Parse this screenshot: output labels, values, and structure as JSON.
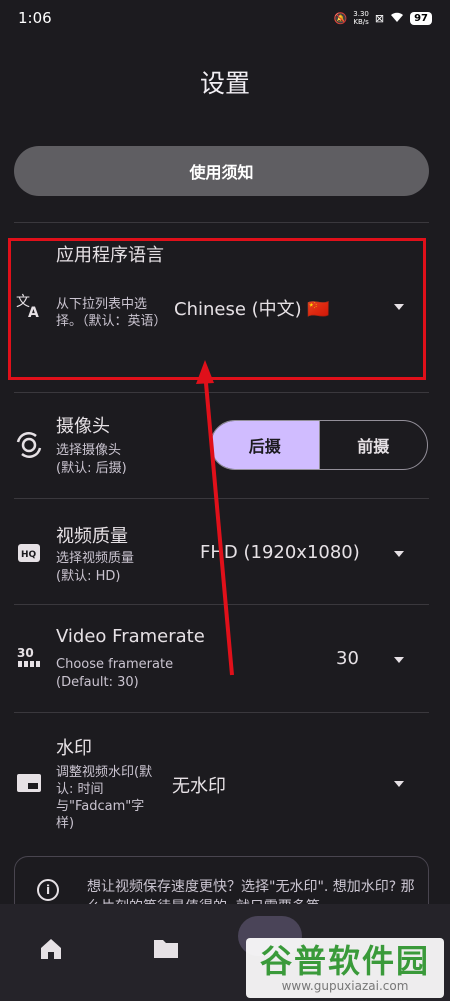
{
  "status": {
    "time": "1:06",
    "speed_value": "3.30",
    "speed_unit": "KB/s",
    "battery": "97"
  },
  "page_title": "设置",
  "notice_button": "使用须知",
  "language": {
    "title": "应用程序语言",
    "desc": "从下拉列表中选择。（默认：英语）",
    "value": "Chinese (中文) 🇨🇳"
  },
  "camera": {
    "title": "摄像头",
    "desc": "选择摄像头",
    "default": "(默认: 后摄)",
    "options": [
      "后摄",
      "前摄"
    ],
    "selected": "后摄"
  },
  "video_quality": {
    "title": "视频质量",
    "desc": "选择视频质量",
    "default": "(默认: HD)",
    "value": "FHD (1920x1080)"
  },
  "framerate": {
    "title": "Video Framerate",
    "desc": "Choose framerate",
    "default": "(Default: 30)",
    "value": "30"
  },
  "watermark_setting": {
    "title": "水印",
    "desc": "调整视频水印(默认: 时间与\"Fadcam\"字样)",
    "value": "无水印"
  },
  "info_card": {
    "text": "想让视频保存速度更快？选择\"无水印\". 想加水印? 那么片刻的等待是值得的, 就只需要多等一"
  },
  "site_watermark": {
    "title": "谷普软件园",
    "url": "www.gupuxiazai.com"
  },
  "colors": {
    "background": "#1c1b1f",
    "accent": "#d0bcff",
    "highlight": "#e0101a"
  }
}
